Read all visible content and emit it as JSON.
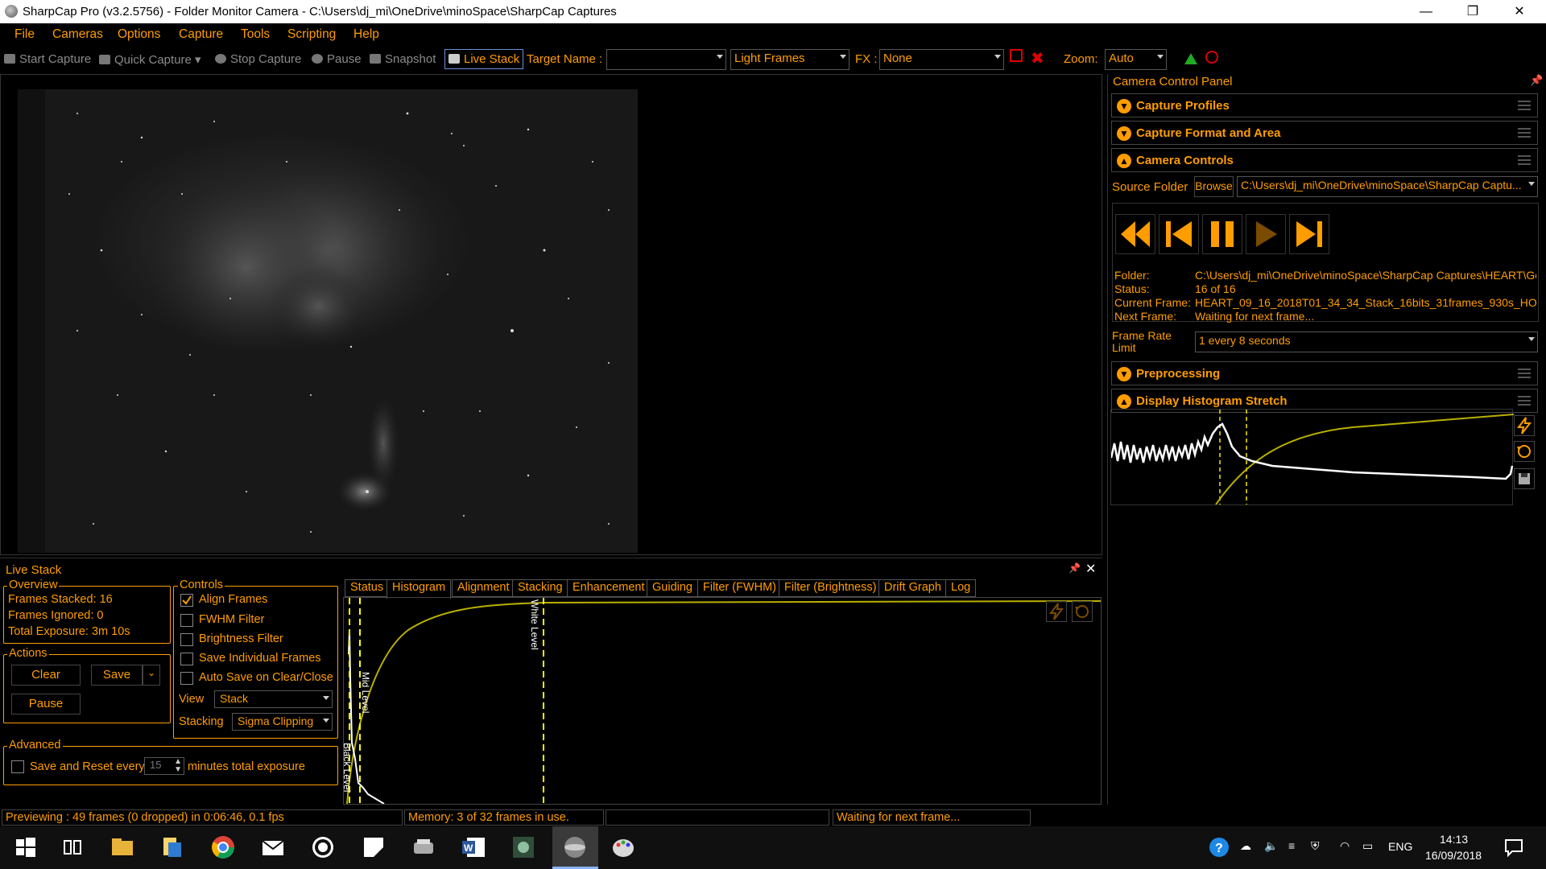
{
  "window": {
    "title": "SharpCap Pro (v3.2.5756) - Folder Monitor Camera - C:\\Users\\dj_mi\\OneDrive\\minoSpace\\SharpCap Captures",
    "minimize": "—",
    "restore": "❐",
    "close": "✕"
  },
  "menu": [
    "File",
    "Cameras",
    "Options",
    "Capture",
    "Tools",
    "Scripting",
    "Help"
  ],
  "toolbar": {
    "start_capture": "Start Capture",
    "quick_capture": "Quick Capture",
    "stop_capture": "Stop Capture",
    "pause": "Pause",
    "snapshot": "Snapshot",
    "live_stack": "Live Stack",
    "target_name_label": "Target Name :",
    "target_name_value": "",
    "frame_type": "Light Frames",
    "fx_label": "FX :",
    "fx_value": "None",
    "zoom_label": "Zoom:",
    "zoom_value": "Auto"
  },
  "camera_panel": {
    "title": "Camera Control Panel",
    "sections": {
      "capture_profiles": "Capture Profiles",
      "capture_format": "Capture Format and Area",
      "camera_controls": "Camera Controls",
      "preprocessing": "Preprocessing",
      "display_histogram": "Display Histogram Stretch"
    },
    "source_folder_label": "Source Folder",
    "browse": "Browse",
    "source_folder_value": "C:\\Users\\dj_mi\\OneDrive\\minoSpace\\SharpCap Captu...",
    "info": {
      "folder_label": "Folder:",
      "folder_value": "C:\\Users\\dj_mi\\OneDrive\\minoSpace\\SharpCap Captures\\HEART\\Go",
      "status_label": "Status:",
      "status_value": "16 of 16",
      "current_label": "Current Frame:",
      "current_value": "HEART_09_16_2018T01_34_34_Stack_16bits_31frames_930s_HO_",
      "next_label": "Next Frame:",
      "next_value": "Waiting for next frame..."
    },
    "frame_rate_label": "Frame Rate Limit",
    "frame_rate_value": "1 every 8 seconds"
  },
  "live_stack": {
    "title": "Live Stack",
    "overview_title": "Overview",
    "frames_stacked": "Frames Stacked:  16",
    "frames_ignored": "Frames Ignored:  0",
    "total_exposure": "Total Exposure:   3m 10s",
    "actions_title": "Actions",
    "clear": "Clear",
    "save": "Save",
    "pause": "Pause",
    "controls_title": "Controls",
    "controls": [
      {
        "label": "Align Frames",
        "checked": true
      },
      {
        "label": "FWHM Filter",
        "checked": false
      },
      {
        "label": "Brightness Filter",
        "checked": false
      },
      {
        "label": "Save Individual Frames",
        "checked": false
      },
      {
        "label": "Auto Save on Clear/Close",
        "checked": false
      }
    ],
    "view_label": "View",
    "view_value": "Stack",
    "stacking_label": "Stacking",
    "stacking_value": "Sigma Clipping",
    "advanced_title": "Advanced",
    "save_reset_label": "Save and Reset every",
    "save_reset_value": "15",
    "minutes_label": "minutes total exposure",
    "tabs": [
      "Status",
      "Histogram",
      "Alignment",
      "Stacking",
      "Enhancement",
      "Guiding",
      "Filter (FWHM)",
      "Filter (Brightness)",
      "Drift Graph",
      "Log"
    ],
    "active_tab": "Histogram",
    "levels": {
      "black": "Black Level",
      "mid": "Mid Level",
      "white": "White Level"
    }
  },
  "status_bar": {
    "previewing": "Previewing : 49 frames (0 dropped) in 0:06:46, 0.1 fps",
    "memory": "Memory: 3 of 32 frames in use.",
    "empty": "",
    "waiting": "Waiting for next frame..."
  },
  "taskbar": {
    "lang": "ENG",
    "time": "14:13",
    "date": "16/09/2018"
  }
}
